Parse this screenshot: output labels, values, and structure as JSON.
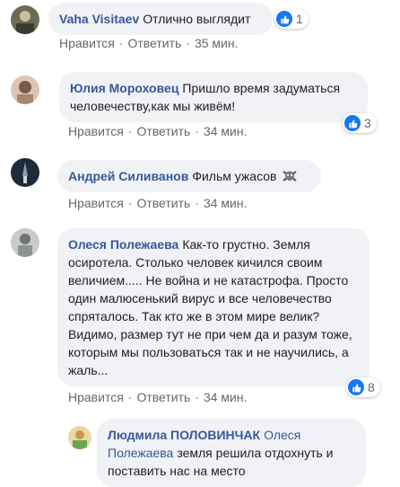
{
  "actions": {
    "like": "Нравится",
    "reply": "Ответить",
    "dot": "·"
  },
  "comments": [
    {
      "author": "Vaha Visitaev",
      "text": "Отлично выглядит",
      "time": "35 мин.",
      "reactions": "1",
      "avatar_icon": "person-photo",
      "colors": [
        "#6b6b55",
        "#c9c0a0"
      ]
    },
    {
      "author": "Юлия Мороховец",
      "text": "Пришло время задуматься человечеству,как мы живём!",
      "time": "34 мин.",
      "reactions": "3",
      "avatar_icon": "person-photo",
      "colors": [
        "#7a5a48",
        "#d9c6b8"
      ]
    },
    {
      "author": "Андрей Силиванов",
      "text": "Фильм ужасов",
      "time": "34 мин.",
      "emoji": "skull-crossbones-icon",
      "avatar_icon": "rocket-photo",
      "colors": [
        "#1f2a3a",
        "#8c9bb0"
      ]
    },
    {
      "author": "Олеся Полежаева",
      "text": "Как-то грустно. Земля осиротела. Столько человек кичился своим величием..... Не война и не катастрофа. Просто один малюсенький вирус и все человечество спряталось. Так кто же в этом мире велик? Видимо, размер тут не при чем да и разум тоже, которым мы пользоваться так и не научились, а жаль...",
      "time": "34 мин.",
      "reactions": "8",
      "avatar_icon": "person-photo",
      "colors": [
        "#6f7373",
        "#c8cbcb"
      ]
    },
    {
      "author": "Людмила ПОЛОВИНЧАК",
      "mention": "Олеся Полежаева",
      "text": "земля решила отдохнуть и поставить нас на место",
      "avatar_icon": "person-photo",
      "colors": [
        "#c79a4a",
        "#e9d8a6"
      ]
    }
  ]
}
